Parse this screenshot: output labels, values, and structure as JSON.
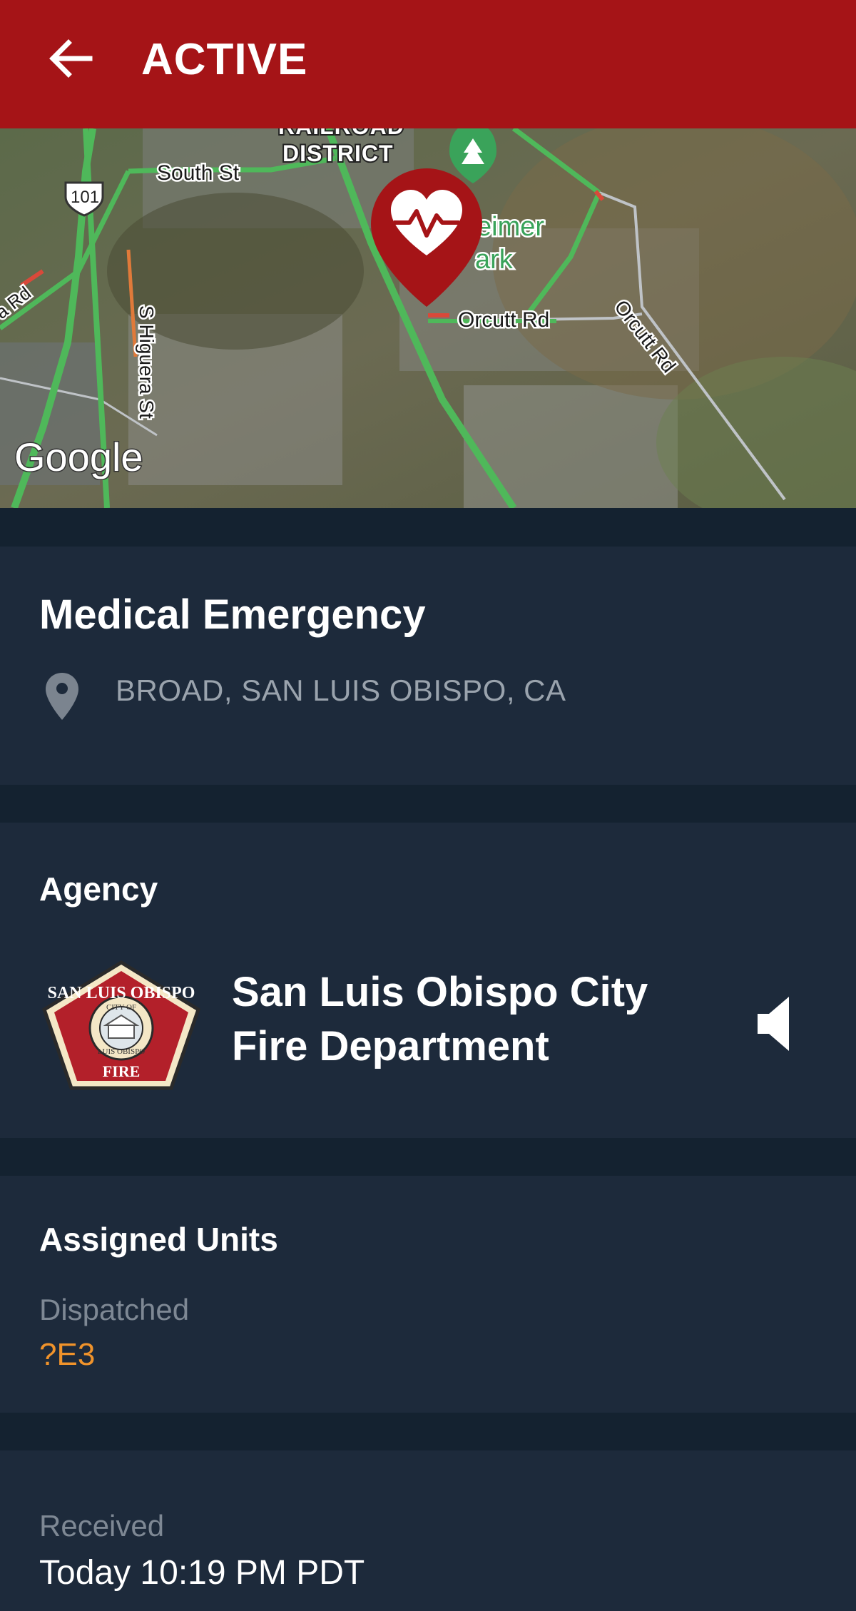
{
  "header": {
    "title": "ACTIVE",
    "back_icon": "arrow-left-icon",
    "background": "#a51417"
  },
  "map": {
    "provider_logo": "Google",
    "labels": {
      "railroad_district_line1": "RAILROAD",
      "railroad_district_line2": "DISTRICT",
      "south_st": "South St",
      "highway_101": "101",
      "s_higuera_st": "S Higuera St",
      "orcutt_rd_1": "Orcutt Rd",
      "orcutt_rd_2": "Orcutt Rd",
      "park_partial_1": "eimer",
      "park_partial_2": "ark",
      "road_partial_left": "a Rd"
    },
    "marker_icon": "heart-pulse-marker-icon"
  },
  "incident": {
    "title": "Medical Emergency",
    "location_icon": "map-pin-icon",
    "address": "BROAD, SAN LUIS OBISPO, CA"
  },
  "agency": {
    "label": "Agency",
    "name_line1": "San Luis Obispo City",
    "name_line2": "Fire Department",
    "seal_text_top": "SAN LUIS OBISPO",
    "seal_text_inner": "CITY OF",
    "seal_text_inner_bottom": "LUIS OBISPO",
    "seal_text_bottom": "FIRE",
    "audio_icon": "speaker-icon"
  },
  "units": {
    "label": "Assigned Units",
    "status": "Dispatched",
    "unit": "?E3"
  },
  "received": {
    "label": "Received",
    "value": "Today 10:19 PM PDT"
  },
  "colors": {
    "accent": "#a51417",
    "card": "#1d2a3b",
    "background": "#142230",
    "unit": "#f0932b"
  }
}
